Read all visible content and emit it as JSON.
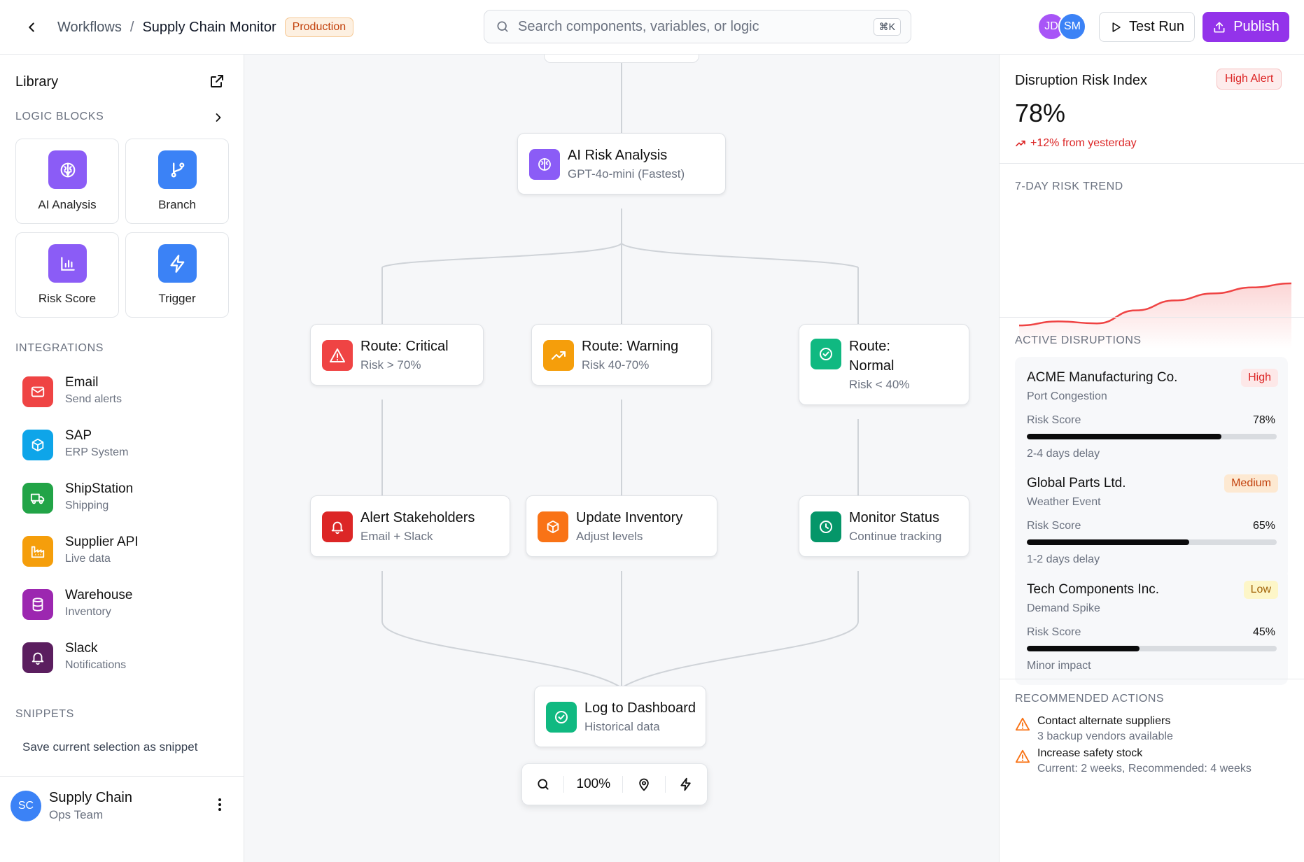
{
  "header": {
    "breadcrumb_root": "Workflows",
    "breadcrumb_sep": "/",
    "workflow_name": "Supply Chain Monitor",
    "env_badge": "Production",
    "search_placeholder": "Search components, variables, or logic",
    "search_shortcut": "⌘K",
    "avatars": [
      "JD",
      "SM"
    ],
    "test_run_label": "Test Run",
    "publish_label": "Publish",
    "colors": {
      "publish": "#9333ea",
      "avatar_1": "#a855f7",
      "avatar_2": "#3b82f6"
    }
  },
  "sidebar": {
    "title": "Library",
    "logic_label": "LOGIC BLOCKS",
    "blocks": [
      {
        "label": "AI Analysis",
        "icon": "brain-icon",
        "color": "#8b5cf6"
      },
      {
        "label": "Branch",
        "icon": "git-branch-icon",
        "color": "#3b82f6"
      },
      {
        "label": "Risk Score",
        "icon": "bar-chart-icon",
        "color": "#8b5cf6"
      },
      {
        "label": "Trigger",
        "icon": "zap-icon",
        "color": "#3b82f6"
      }
    ],
    "integrations_label": "INTEGRATIONS",
    "integrations": [
      {
        "name": "Email",
        "sub": "Send alerts",
        "icon": "mail-icon",
        "color": "#ef4444"
      },
      {
        "name": "SAP",
        "sub": "ERP System",
        "icon": "box-icon",
        "color": "#0ea5e9"
      },
      {
        "name": "ShipStation",
        "sub": "Shipping",
        "icon": "truck-icon",
        "color": "#22a447"
      },
      {
        "name": "Supplier API",
        "sub": "Live data",
        "icon": "factory-icon",
        "color": "#f59e0b"
      },
      {
        "name": "Warehouse",
        "sub": "Inventory",
        "icon": "database-icon",
        "color": "#9c27b0"
      },
      {
        "name": "Slack",
        "sub": "Notifications",
        "icon": "bell-icon",
        "color": "#5b1e5f"
      }
    ],
    "snippets_label": "SNIPPETS",
    "snippet_save": "Save current selection as snippet",
    "footer": {
      "initials": "SC",
      "name": "Supply Chain",
      "team": "Ops Team"
    }
  },
  "canvas": {
    "nodes": {
      "ai": {
        "title": "AI Risk Analysis",
        "sub": "GPT-4o-mini (Fastest)"
      },
      "critical": {
        "title": "Route: Critical",
        "sub": "Risk > 70%"
      },
      "warning": {
        "title": "Route: Warning",
        "sub": "Risk 40-70%"
      },
      "normal": {
        "title_1": "Route:",
        "title_2": "Normal",
        "sub": "Risk < 40%"
      },
      "alert": {
        "title": "Alert Stakeholders",
        "sub": "Email + Slack"
      },
      "inventory": {
        "title": "Update Inventory",
        "sub": "Adjust levels"
      },
      "monitor": {
        "title": "Monitor Status",
        "sub": "Continue tracking"
      },
      "log": {
        "title": "Log to Dashboard",
        "sub": "Historical data"
      }
    },
    "zoom_label": "100%"
  },
  "right_panel": {
    "title": "Disruption Risk Index",
    "alert_badge": "High Alert",
    "value": "78%",
    "change": "+12% from yesterday",
    "trend_label": "7-DAY RISK TREND",
    "trend_series": [
      30,
      34,
      32,
      45,
      55,
      62,
      68,
      72
    ],
    "trend_color": "#ef4444",
    "disruptions_label": "ACTIVE DISRUPTIONS",
    "disruptions": [
      {
        "name": "ACME Manufacturing Co.",
        "cause": "Port Congestion",
        "level": "High",
        "risk_label": "Risk Score",
        "risk": "78%",
        "risk_value": 78,
        "delay": "2-4 days delay"
      },
      {
        "name": "Global Parts Ltd.",
        "cause": "Weather Event",
        "level": "Medium",
        "risk_label": "Risk Score",
        "risk": "65%",
        "risk_value": 65,
        "delay": "1-2 days delay"
      },
      {
        "name": "Tech Components Inc.",
        "cause": "Demand Spike",
        "level": "Low",
        "risk_label": "Risk Score",
        "risk": "45%",
        "risk_value": 45,
        "delay": "Minor impact"
      }
    ],
    "actions_label": "RECOMMENDED ACTIONS",
    "actions": [
      {
        "title": "Contact alternate suppliers",
        "sub": "3 backup vendors available"
      },
      {
        "title": "Increase safety stock",
        "sub": "Current: 2 weeks, Recommended: 4 weeks"
      }
    ]
  }
}
